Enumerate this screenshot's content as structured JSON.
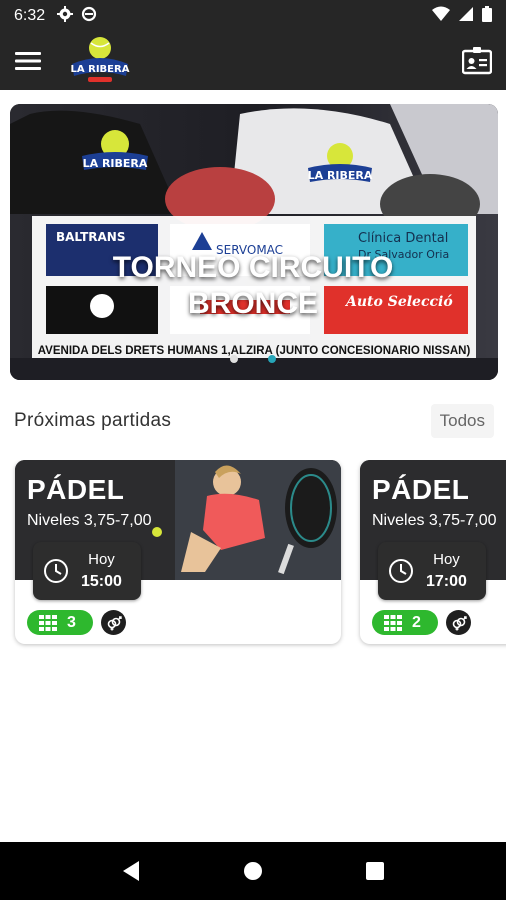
{
  "status_bar": {
    "time": "6:32",
    "left_icons": [
      "gear-icon",
      "data-saver-icon"
    ],
    "right_icons": [
      "wifi-icon",
      "signal-icon",
      "battery-icon"
    ]
  },
  "app_bar": {
    "logo_text": "LA RIBERA",
    "menu_icon": "hamburger-menu-icon",
    "profile_icon": "id-card-icon"
  },
  "banner": {
    "title_line1": "TORNEO CIRCUITO",
    "title_line2": "BRONCE",
    "sponsor_logos": [
      "LA RIBERA",
      "LA RIBERA",
      "BALTRANS",
      "SERVOMAC",
      "Clínica Dental",
      "Dr Salvador Oria",
      "Auto Selecció"
    ],
    "footer_text": "AVENIDA DELS DRETS HUMANS 1,ALZIRA (JUNTO CONCESIONARIO NISSAN)",
    "slide_count": 2,
    "active_slide": 2,
    "dot_inactive_color": "#e0e0e0",
    "dot_active_color": "#26a5b8"
  },
  "section": {
    "title": "Próximas partidas",
    "all_button": "Todos"
  },
  "matches": [
    {
      "sport": "PÁDEL",
      "levels": "Niveles 3,75-7,00",
      "day": "Hoy",
      "hour": "15:00",
      "courts": "3",
      "gender_icon": "mixed-gender-icon"
    },
    {
      "sport": "PÁDEL",
      "levels": "Niveles 3,75-7,00",
      "day": "Hoy",
      "hour": "17:00",
      "courts": "2",
      "gender_icon": "mixed-gender-icon"
    }
  ],
  "colors": {
    "bar_dark": "#262626",
    "badge_green": "#2eb82e",
    "accent_teal": "#26a5b8"
  },
  "nav_bar": [
    "back-icon",
    "home-icon",
    "recents-icon"
  ]
}
